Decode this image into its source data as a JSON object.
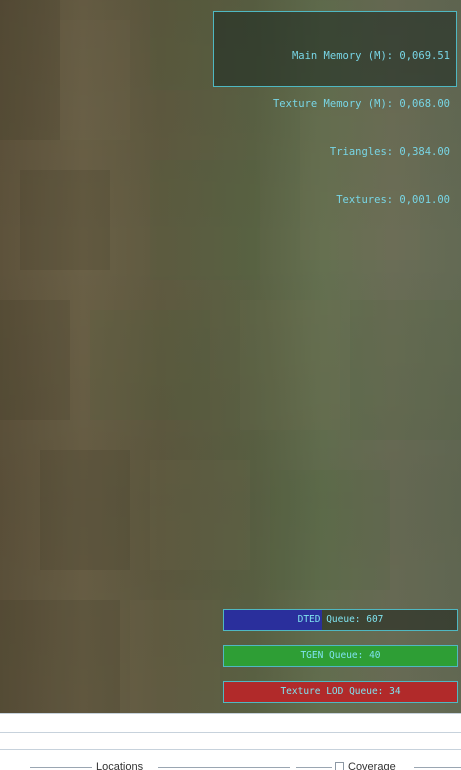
{
  "stats": {
    "main_memory": "Main Memory (M): 0,069.51",
    "texture_memory": "Texture Memory (M): 0,068.00",
    "triangles": "Triangles: 0,384.00",
    "textures": "Textures: 0,001.00"
  },
  "queues": {
    "dted": {
      "label": "DTED Queue: 607",
      "fill_fraction": 0.42
    },
    "tgen": {
      "label": "TGEN Queue: 40",
      "fill_fraction": 1.0
    },
    "texlod": {
      "label": "Texture LOD Queue: 34",
      "fill_fraction": 1.0
    }
  },
  "bottom_panel": {
    "locations_title": "Locations",
    "coverage_label": "Coverage",
    "coverage_checked": false
  },
  "colors": {
    "overlay_text": "#78d6e6",
    "overlay_border": "#4fb8c2",
    "dted_fill": "#2a2f9c",
    "tgen_fill": "#2e9e35",
    "texlod_fill": "#b12a2a"
  }
}
